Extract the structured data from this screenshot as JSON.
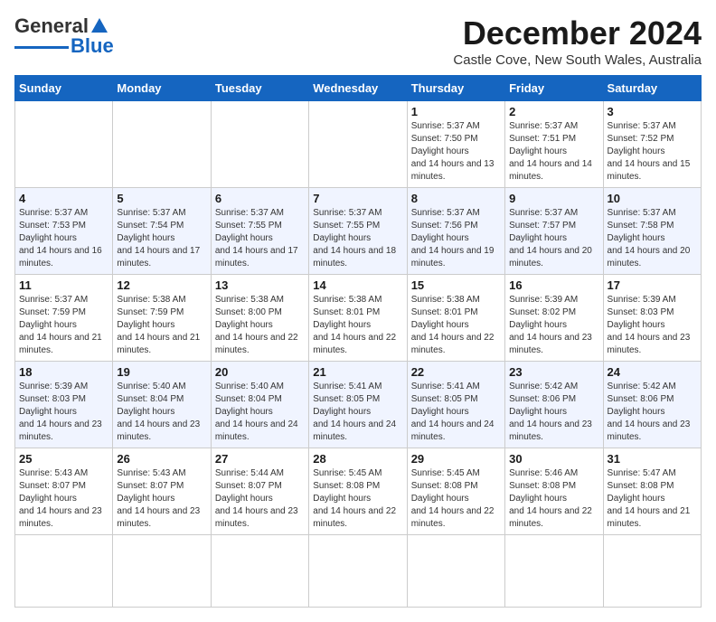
{
  "logo": {
    "general": "General",
    "blue": "Blue"
  },
  "title": "December 2024",
  "location": "Castle Cove, New South Wales, Australia",
  "weekdays": [
    "Sunday",
    "Monday",
    "Tuesday",
    "Wednesday",
    "Thursday",
    "Friday",
    "Saturday"
  ],
  "days": [
    {
      "date": "",
      "empty": true
    },
    {
      "date": "",
      "empty": true
    },
    {
      "date": "",
      "empty": true
    },
    {
      "date": "",
      "empty": true
    },
    {
      "num": "1",
      "sunrise": "5:37 AM",
      "sunset": "7:50 PM",
      "daylight": "14 hours and 13 minutes."
    },
    {
      "num": "2",
      "sunrise": "5:37 AM",
      "sunset": "7:51 PM",
      "daylight": "14 hours and 14 minutes."
    },
    {
      "num": "3",
      "sunrise": "5:37 AM",
      "sunset": "7:52 PM",
      "daylight": "14 hours and 15 minutes."
    },
    {
      "num": "4",
      "sunrise": "5:37 AM",
      "sunset": "7:53 PM",
      "daylight": "14 hours and 16 minutes."
    },
    {
      "num": "5",
      "sunrise": "5:37 AM",
      "sunset": "7:54 PM",
      "daylight": "14 hours and 17 minutes."
    },
    {
      "num": "6",
      "sunrise": "5:37 AM",
      "sunset": "7:55 PM",
      "daylight": "14 hours and 17 minutes."
    },
    {
      "num": "7",
      "sunrise": "5:37 AM",
      "sunset": "7:55 PM",
      "daylight": "14 hours and 18 minutes."
    },
    {
      "num": "8",
      "sunrise": "5:37 AM",
      "sunset": "7:56 PM",
      "daylight": "14 hours and 19 minutes."
    },
    {
      "num": "9",
      "sunrise": "5:37 AM",
      "sunset": "7:57 PM",
      "daylight": "14 hours and 20 minutes."
    },
    {
      "num": "10",
      "sunrise": "5:37 AM",
      "sunset": "7:58 PM",
      "daylight": "14 hours and 20 minutes."
    },
    {
      "num": "11",
      "sunrise": "5:37 AM",
      "sunset": "7:59 PM",
      "daylight": "14 hours and 21 minutes."
    },
    {
      "num": "12",
      "sunrise": "5:38 AM",
      "sunset": "7:59 PM",
      "daylight": "14 hours and 21 minutes."
    },
    {
      "num": "13",
      "sunrise": "5:38 AM",
      "sunset": "8:00 PM",
      "daylight": "14 hours and 22 minutes."
    },
    {
      "num": "14",
      "sunrise": "5:38 AM",
      "sunset": "8:01 PM",
      "daylight": "14 hours and 22 minutes."
    },
    {
      "num": "15",
      "sunrise": "5:38 AM",
      "sunset": "8:01 PM",
      "daylight": "14 hours and 22 minutes."
    },
    {
      "num": "16",
      "sunrise": "5:39 AM",
      "sunset": "8:02 PM",
      "daylight": "14 hours and 23 minutes."
    },
    {
      "num": "17",
      "sunrise": "5:39 AM",
      "sunset": "8:03 PM",
      "daylight": "14 hours and 23 minutes."
    },
    {
      "num": "18",
      "sunrise": "5:39 AM",
      "sunset": "8:03 PM",
      "daylight": "14 hours and 23 minutes."
    },
    {
      "num": "19",
      "sunrise": "5:40 AM",
      "sunset": "8:04 PM",
      "daylight": "14 hours and 23 minutes."
    },
    {
      "num": "20",
      "sunrise": "5:40 AM",
      "sunset": "8:04 PM",
      "daylight": "14 hours and 24 minutes."
    },
    {
      "num": "21",
      "sunrise": "5:41 AM",
      "sunset": "8:05 PM",
      "daylight": "14 hours and 24 minutes."
    },
    {
      "num": "22",
      "sunrise": "5:41 AM",
      "sunset": "8:05 PM",
      "daylight": "14 hours and 24 minutes."
    },
    {
      "num": "23",
      "sunrise": "5:42 AM",
      "sunset": "8:06 PM",
      "daylight": "14 hours and 23 minutes."
    },
    {
      "num": "24",
      "sunrise": "5:42 AM",
      "sunset": "8:06 PM",
      "daylight": "14 hours and 23 minutes."
    },
    {
      "num": "25",
      "sunrise": "5:43 AM",
      "sunset": "8:07 PM",
      "daylight": "14 hours and 23 minutes."
    },
    {
      "num": "26",
      "sunrise": "5:43 AM",
      "sunset": "8:07 PM",
      "daylight": "14 hours and 23 minutes."
    },
    {
      "num": "27",
      "sunrise": "5:44 AM",
      "sunset": "8:07 PM",
      "daylight": "14 hours and 23 minutes."
    },
    {
      "num": "28",
      "sunrise": "5:45 AM",
      "sunset": "8:08 PM",
      "daylight": "14 hours and 22 minutes."
    },
    {
      "num": "29",
      "sunrise": "5:45 AM",
      "sunset": "8:08 PM",
      "daylight": "14 hours and 22 minutes."
    },
    {
      "num": "30",
      "sunrise": "5:46 AM",
      "sunset": "8:08 PM",
      "daylight": "14 hours and 22 minutes."
    },
    {
      "num": "31",
      "sunrise": "5:47 AM",
      "sunset": "8:08 PM",
      "daylight": "14 hours and 21 minutes."
    },
    {
      "date": "",
      "empty": true
    },
    {
      "date": "",
      "empty": true
    },
    {
      "date": "",
      "empty": true
    },
    {
      "date": "",
      "empty": true
    }
  ]
}
